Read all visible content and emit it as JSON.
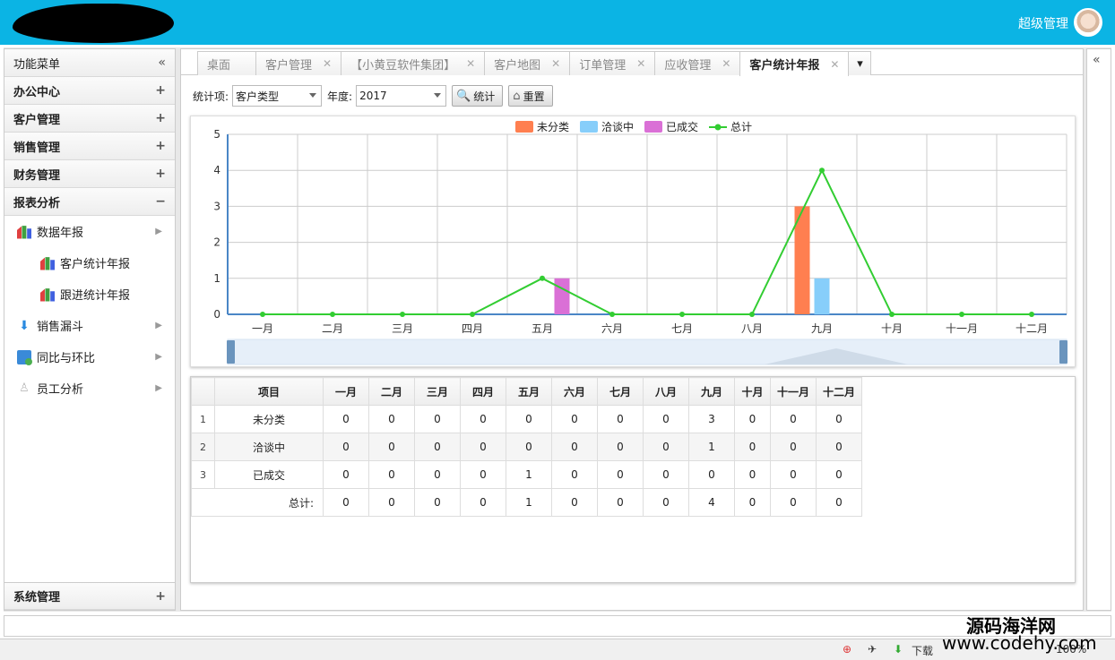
{
  "header": {
    "user_name": "超级管理"
  },
  "sidebar": {
    "title": "功能菜单",
    "collapse_icon": "«",
    "groups": [
      {
        "label": "办公中心",
        "toggle": "+"
      },
      {
        "label": "客户管理",
        "toggle": "+"
      },
      {
        "label": "销售管理",
        "toggle": "+"
      },
      {
        "label": "财务管理",
        "toggle": "+"
      },
      {
        "label": "报表分析",
        "toggle": "−"
      }
    ],
    "items": [
      {
        "label": "数据年报",
        "icon": "chart-icon"
      },
      {
        "label": "客户统计年报",
        "icon": "chart-icon"
      },
      {
        "label": "跟进统计年报",
        "icon": "chart-icon"
      },
      {
        "label": "销售漏斗",
        "icon": "funnel-icon"
      },
      {
        "label": "同比与环比",
        "icon": "compare-icon"
      },
      {
        "label": "员工分析",
        "icon": "user-icon"
      }
    ],
    "bottom": {
      "label": "系统管理",
      "toggle": "+"
    }
  },
  "tabs": [
    {
      "label": "桌面"
    },
    {
      "label": "客户管理"
    },
    {
      "label": "【小黄豆软件集团】"
    },
    {
      "label": "客户地图"
    },
    {
      "label": "订单管理"
    },
    {
      "label": "应收管理"
    },
    {
      "label": "客户统计年报"
    }
  ],
  "toolbar": {
    "item_label": "统计项:",
    "item_value": "客户类型",
    "year_label": "年度:",
    "year_value": "2017",
    "stat_button": "统计",
    "reset_button": "重置"
  },
  "chart_data": {
    "type": "bar",
    "categories": [
      "一月",
      "二月",
      "三月",
      "四月",
      "五月",
      "六月",
      "七月",
      "八月",
      "九月",
      "十月",
      "十一月",
      "十二月"
    ],
    "series": [
      {
        "name": "未分类",
        "type": "bar",
        "color": "#ff7f50",
        "values": [
          0,
          0,
          0,
          0,
          0,
          0,
          0,
          0,
          3,
          0,
          0,
          0
        ]
      },
      {
        "name": "洽谈中",
        "type": "bar",
        "color": "#87cefa",
        "values": [
          0,
          0,
          0,
          0,
          0,
          0,
          0,
          0,
          1,
          0,
          0,
          0
        ]
      },
      {
        "name": "已成交",
        "type": "bar",
        "color": "#da70d6",
        "values": [
          0,
          0,
          0,
          0,
          1,
          0,
          0,
          0,
          0,
          0,
          0,
          0
        ]
      },
      {
        "name": "总计",
        "type": "line",
        "color": "#32cd32",
        "values": [
          0,
          0,
          0,
          0,
          1,
          0,
          0,
          0,
          4,
          0,
          0,
          0
        ]
      }
    ],
    "yticks": [
      "0",
      "1",
      "2",
      "3",
      "4",
      "5"
    ],
    "ylim": [
      0,
      5
    ],
    "grid": true,
    "legend": "top-center"
  },
  "table": {
    "headers": [
      "项目",
      "一月",
      "二月",
      "三月",
      "四月",
      "五月",
      "六月",
      "七月",
      "八月",
      "九月",
      "十月",
      "十一月",
      "十二月"
    ],
    "rows": [
      {
        "n": "1",
        "cells": [
          "未分类",
          "0",
          "0",
          "0",
          "0",
          "0",
          "0",
          "0",
          "0",
          "3",
          "0",
          "0",
          "0"
        ]
      },
      {
        "n": "2",
        "cells": [
          "洽谈中",
          "0",
          "0",
          "0",
          "0",
          "0",
          "0",
          "0",
          "0",
          "1",
          "0",
          "0",
          "0"
        ]
      },
      {
        "n": "3",
        "cells": [
          "已成交",
          "0",
          "0",
          "0",
          "0",
          "1",
          "0",
          "0",
          "0",
          "0",
          "0",
          "0",
          "0"
        ]
      }
    ],
    "total_label": "总计:",
    "totals": [
      "0",
      "0",
      "0",
      "0",
      "1",
      "0",
      "0",
      "0",
      "4",
      "0",
      "0",
      "0"
    ]
  },
  "statusbar": {
    "download": "下载",
    "zoom": "100%"
  },
  "watermark": {
    "line1": "源码海洋网",
    "line2": "www.codehy.com"
  }
}
